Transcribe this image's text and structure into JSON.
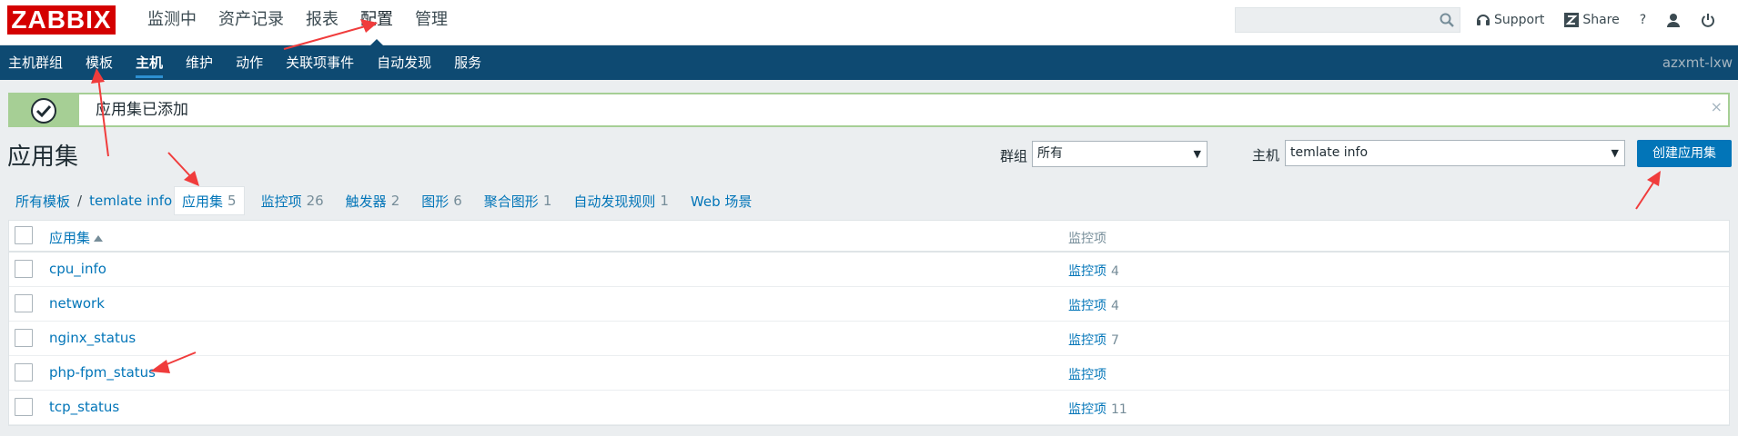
{
  "logo": "ZABBIX",
  "top_menu": [
    {
      "label": "监测中"
    },
    {
      "label": "资产记录"
    },
    {
      "label": "报表"
    },
    {
      "label": "配置"
    },
    {
      "label": "管理"
    }
  ],
  "top_links": {
    "support": "Support",
    "share": "Share",
    "help": "?"
  },
  "sub_menu": [
    {
      "label": "主机群组"
    },
    {
      "label": "模板"
    },
    {
      "label": "主机"
    },
    {
      "label": "维护"
    },
    {
      "label": "动作"
    },
    {
      "label": "关联项事件"
    },
    {
      "label": "自动发现"
    },
    {
      "label": "服务"
    }
  ],
  "user": "azxmt-lxw",
  "message": {
    "text": "应用集已添加",
    "close": "×"
  },
  "page_title": "应用集",
  "filter": {
    "group_label": "群组",
    "group_value": "所有",
    "host_label": "主机",
    "host_value": "temlate info"
  },
  "create_button": "创建应用集",
  "breadcrumb": {
    "root": "所有模板",
    "sep": "/",
    "current": "temlate info"
  },
  "tabs": [
    {
      "label": "应用集",
      "count": "5"
    },
    {
      "label": "监控项",
      "count": "26"
    },
    {
      "label": "触发器",
      "count": "2"
    },
    {
      "label": "图形",
      "count": "6"
    },
    {
      "label": "聚合图形",
      "count": "1"
    },
    {
      "label": "自动发现规则",
      "count": "1"
    },
    {
      "label": "Web 场景",
      "count": ""
    }
  ],
  "table": {
    "headers": {
      "name": "应用集",
      "items": "监控项"
    },
    "rows": [
      {
        "name": "cpu_info",
        "items_label": "监控项",
        "items_count": "4"
      },
      {
        "name": "network",
        "items_label": "监控项",
        "items_count": "4"
      },
      {
        "name": "nginx_status",
        "items_label": "监控项",
        "items_count": "7"
      },
      {
        "name": "php-fpm_status",
        "items_label": "监控项",
        "items_count": ""
      },
      {
        "name": "tcp_status",
        "items_label": "监控项",
        "items_count": "11"
      }
    ]
  },
  "colors": {
    "brand": "#d40000",
    "nav": "#0e4a72",
    "link": "#0275b8",
    "success": "#a6cf95",
    "annotation": "#f03c3c"
  }
}
